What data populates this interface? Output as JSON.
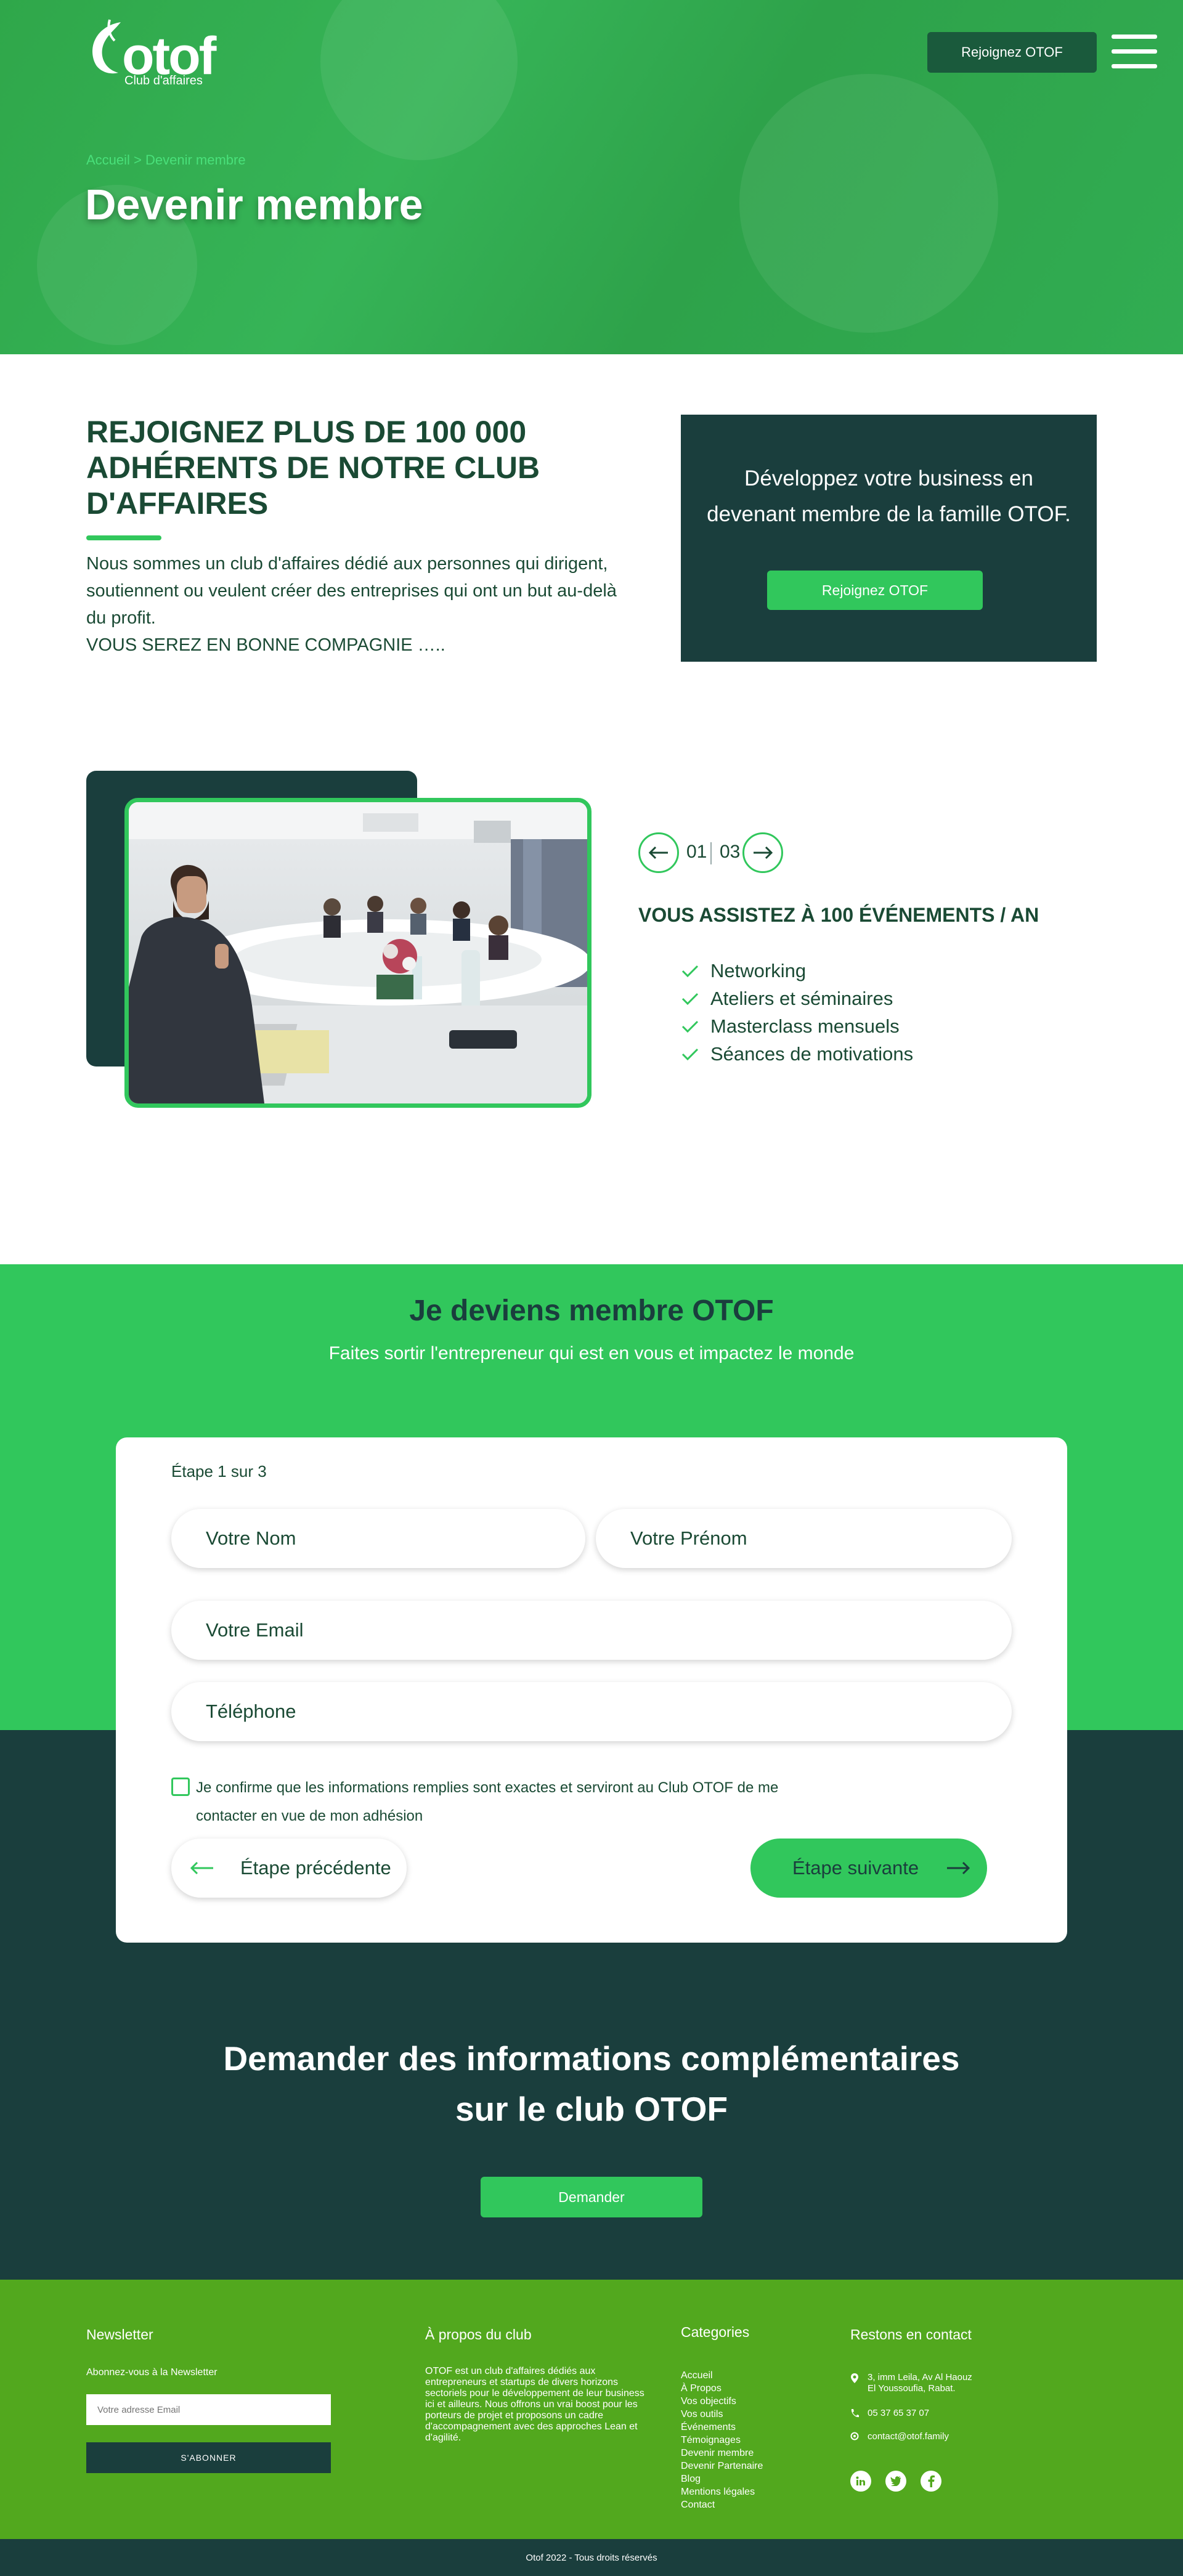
{
  "header": {
    "logo_text": "otof",
    "logo_sub": "Club d'affaires",
    "join_button": "Rejoignez OTOF",
    "breadcrumb": "Accueil > Devenir membre",
    "title": "Devenir membre",
    "menu_icon": "hamburger-menu-icon"
  },
  "intro": {
    "title": "REJOIGNEZ PLUS DE 100 000 ADHÉRENTS DE NOTRE CLUB D'AFFAIRES",
    "text": "Nous sommes un club d'affaires dédié aux personnes qui dirigent, soutiennent ou veulent créer des entreprises qui ont  un but au-delà du profit.",
    "tagline": "VOUS SEREZ EN BONNE COMPAGNIE …..",
    "cta_text": "Développez votre business en devenant membre de la famille OTOF.",
    "cta_button": "Rejoignez OTOF"
  },
  "events": {
    "counter_current": "01",
    "counter_total": "03",
    "title": "VOUS ASSISTEZ À 100 ÉVÉNEMENTS / AN",
    "features": [
      "Networking",
      "Ateliers et séminaires",
      "Masterclass mensuels",
      "Séances de motivations"
    ]
  },
  "form": {
    "title": "Je deviens membre OTOF",
    "subtitle": "Faites sortir l'entrepreneur qui est en vous et impactez le monde",
    "step": "Étape 1 sur 3",
    "placeholders": {
      "nom": "Votre Nom",
      "prenom": "Votre Prénom",
      "email": "Votre Email",
      "telephone": "Téléphone"
    },
    "consent": "Je confirme que les informations remplies sont exactes et serviront au Club OTOF de me contacter en vue de mon adhésion",
    "prev_button": "Étape précédente",
    "next_button": "Étape suivante"
  },
  "info": {
    "title_line1": "Demander des informations complémentaires",
    "title_line2": "sur le club OTOF",
    "button": "Demander"
  },
  "footer": {
    "newsletter_title": "Newsletter",
    "newsletter_label": "Abonnez-vous à la Newsletter",
    "newsletter_placeholder": "Votre adresse Email",
    "newsletter_button": "S'ABONNER",
    "about_title": "À propos du club",
    "about_text": "OTOF est un club d'affaires dédiés aux entrepreneurs et startups de divers horizons sectoriels pour le développement de leur business ici et ailleurs. Nous offrons un vrai boost pour les porteurs de projet et proposons un cadre d'accompagnement avec des approches Lean et d'agilité.",
    "categories_title": "Categories",
    "categories": [
      "Accueil",
      "À Propos",
      "Vos objectifs",
      "Vos outils",
      "Événements",
      "Témoignages",
      "Devenir membre",
      "Devenir Partenaire",
      "Blog",
      "Mentions légales",
      "Contact"
    ],
    "contact_title": "Restons en contact",
    "address_line1": "3, imm Leila, Av Al Haouz",
    "address_line2": "El Youssoufia, Rabat.",
    "phone": "05 37 65 37 07",
    "email": "contact@otof.family",
    "social_icons": [
      "linkedin-icon",
      "twitter-icon",
      "facebook-icon"
    ],
    "copyright": "Otof 2022 - Tous droits réservés"
  },
  "colors": {
    "brand_green": "#31c75c",
    "dark_teal": "#1a3e3d",
    "footer_green": "#52a81e",
    "text_dark": "#1a4a34"
  }
}
